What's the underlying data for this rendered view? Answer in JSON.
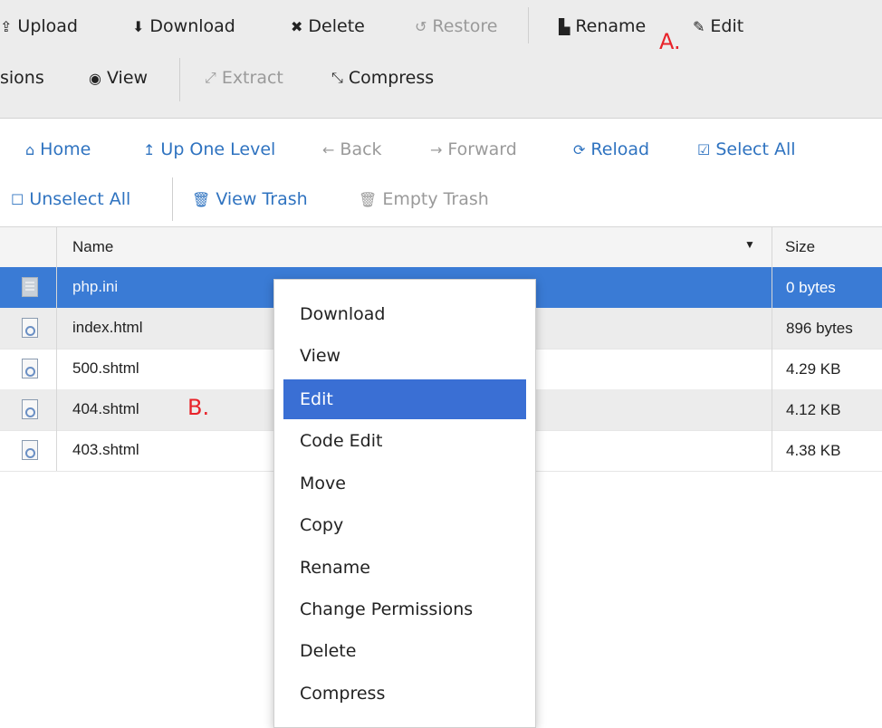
{
  "toolbar": {
    "row1": [
      {
        "icon": "upload-icon",
        "glyph": "⇪",
        "label": "Upload",
        "disabled": false
      },
      {
        "icon": "download-icon",
        "glyph": "⬇",
        "label": "Download",
        "disabled": false
      },
      {
        "icon": "delete-icon",
        "glyph": "✖",
        "label": "Delete",
        "disabled": false
      },
      {
        "icon": "restore-icon",
        "glyph": "↺",
        "label": "Restore",
        "disabled": true
      },
      {
        "icon": "file-icon",
        "glyph": "▙",
        "label": "Rename",
        "disabled": false
      },
      {
        "icon": "pencil-icon",
        "glyph": "✎",
        "label": "Edit",
        "disabled": false
      }
    ],
    "row2": [
      {
        "label": "sions",
        "disabled": false
      },
      {
        "icon": "eye-icon",
        "glyph": "◉",
        "label": "View",
        "disabled": false
      },
      {
        "icon": "extract-icon",
        "glyph": "⤢",
        "label": "Extract",
        "disabled": true
      },
      {
        "icon": "compress-icon",
        "glyph": "⤡",
        "label": "Compress",
        "disabled": false
      }
    ]
  },
  "nav": {
    "row1": [
      {
        "icon": "home-icon",
        "glyph": "⌂",
        "label": "Home",
        "disabled": false
      },
      {
        "icon": "level-up-icon",
        "glyph": "↥",
        "label": "Up One Level",
        "disabled": false
      },
      {
        "icon": "arrow-left-icon",
        "glyph": "←",
        "label": "Back",
        "disabled": true
      },
      {
        "icon": "arrow-right-icon",
        "glyph": "→",
        "label": "Forward",
        "disabled": true
      },
      {
        "icon": "reload-icon",
        "glyph": "⟳",
        "label": "Reload",
        "disabled": false
      },
      {
        "icon": "check-square-icon",
        "glyph": "☑",
        "label": "Select All",
        "disabled": false
      }
    ],
    "row2": [
      {
        "icon": "square-icon",
        "glyph": "☐",
        "label": "Unselect All",
        "disabled": false
      },
      {
        "icon": "trash-icon",
        "glyph": "🗑",
        "label": "View Trash",
        "disabled": false
      },
      {
        "icon": "trash-icon",
        "glyph": "🗑",
        "label": "Empty Trash",
        "disabled": true
      }
    ]
  },
  "annotations": {
    "a": "A.",
    "b": "B."
  },
  "table": {
    "columns": {
      "name": "Name",
      "size": "Size",
      "sort_glyph": "▼"
    },
    "rows": [
      {
        "name": "php.ini",
        "size": "0 bytes",
        "selected": true,
        "type": "ini"
      },
      {
        "name": "index.html",
        "size": "896 bytes",
        "selected": false,
        "type": "html"
      },
      {
        "name": "500.shtml",
        "size": "4.29 KB",
        "selected": false,
        "type": "html"
      },
      {
        "name": "404.shtml",
        "size": "4.12 KB",
        "selected": false,
        "type": "html"
      },
      {
        "name": "403.shtml",
        "size": "4.38 KB",
        "selected": false,
        "type": "html"
      }
    ]
  },
  "context_menu": {
    "items": [
      "Download",
      "View",
      "Edit",
      "Code Edit",
      "Move",
      "Copy",
      "Rename",
      "Change Permissions",
      "Delete",
      "Compress"
    ],
    "active": "Edit"
  },
  "colors": {
    "selection": "#3a7bd5",
    "link": "#2f73c0",
    "annotation": "#e8232a"
  }
}
